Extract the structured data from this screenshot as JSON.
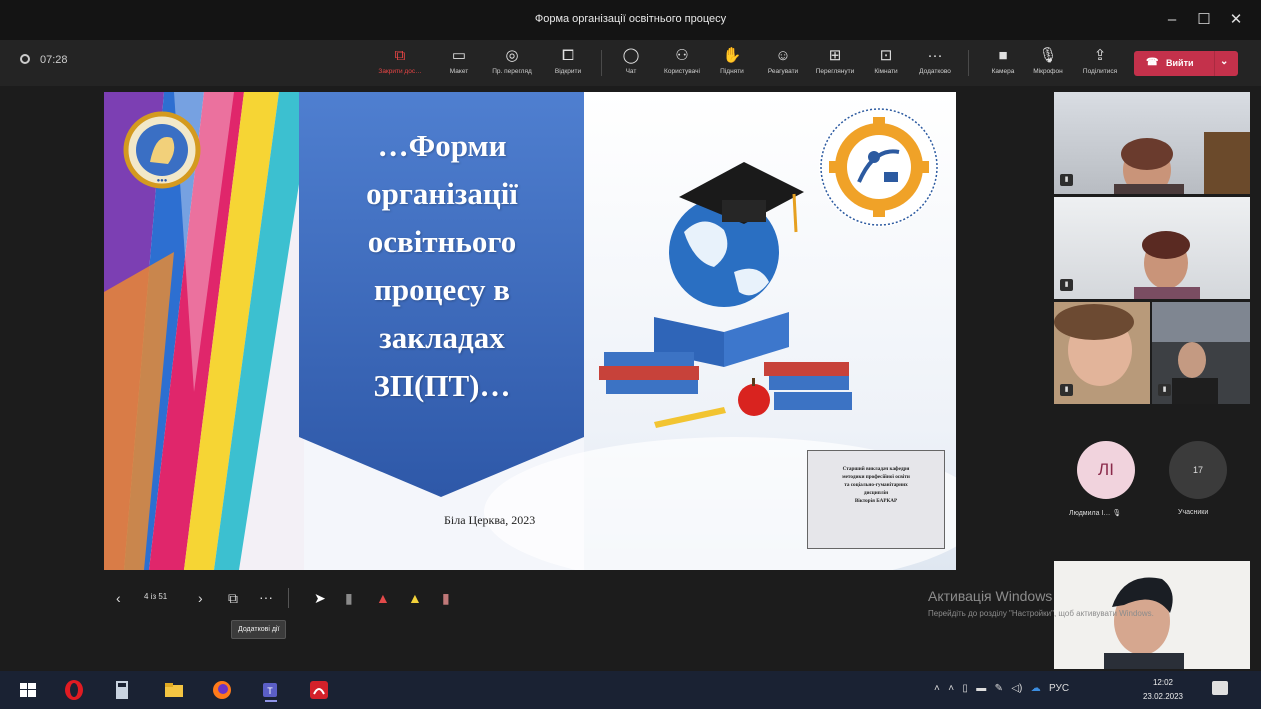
{
  "window": {
    "title": "Форма організації освітнього процесу",
    "minimize": "–",
    "maximize": "☐",
    "close": "✕"
  },
  "toolbar": {
    "timer": "07:28",
    "buttons": [
      {
        "label": "Закрити дос…",
        "icon": "present-stop-icon"
      },
      {
        "label": "Макет",
        "icon": "layout-icon"
      },
      {
        "label": "Пр. перегляд",
        "icon": "eye-icon"
      },
      {
        "label": "Відкрити",
        "icon": "popout-icon"
      },
      {
        "label": "Чат",
        "icon": "chat-icon"
      },
      {
        "label": "Користувачі",
        "icon": "people-icon"
      },
      {
        "label": "Підняти",
        "icon": "raise-hand-icon"
      },
      {
        "label": "Реагувати",
        "icon": "smile-icon"
      },
      {
        "label": "Переглянути",
        "icon": "rooms-icon"
      },
      {
        "label": "Кімнати",
        "icon": "apps-icon"
      },
      {
        "label": "Додатково",
        "icon": "more-icon"
      },
      {
        "label": "Камера",
        "icon": "camera-icon"
      },
      {
        "label": "Мікрофон",
        "icon": "mic-icon"
      },
      {
        "label": "Поділитися",
        "icon": "share-icon"
      }
    ],
    "leave_label": "Вийти"
  },
  "slide": {
    "title_lines": [
      "…Форми",
      "організації",
      "освітнього",
      "процесу в",
      "закладах",
      "ЗП(ПТ)…"
    ],
    "city_year": "Біла Церква, 2023",
    "author_lines": [
      "Старший викладач кафедри",
      "методики професійної освіти",
      "та соціально-гуманітарних",
      "дисциплін",
      "Вікторія БАРКАР"
    ]
  },
  "participants": {
    "avatar_initials": "ЛІ",
    "avatar_name": "Людмила І…",
    "count": "17",
    "count_label": "Учасники"
  },
  "slide_controls": {
    "prev": "‹",
    "page": "4 із 51",
    "next": "›",
    "more": "···",
    "tooltip": "Додаткові дії"
  },
  "activation": {
    "title": "Активація Windows",
    "text": "Перейдіть до розділу \"Настройки\", щоб активувати Windows."
  },
  "taskbar": {
    "lang": "РУС",
    "time": "12:02",
    "date": "23.02.2023"
  },
  "colors": {
    "leave": "#c4314b",
    "banner": "#3f6cbf",
    "teams": "#5b5fc7"
  }
}
